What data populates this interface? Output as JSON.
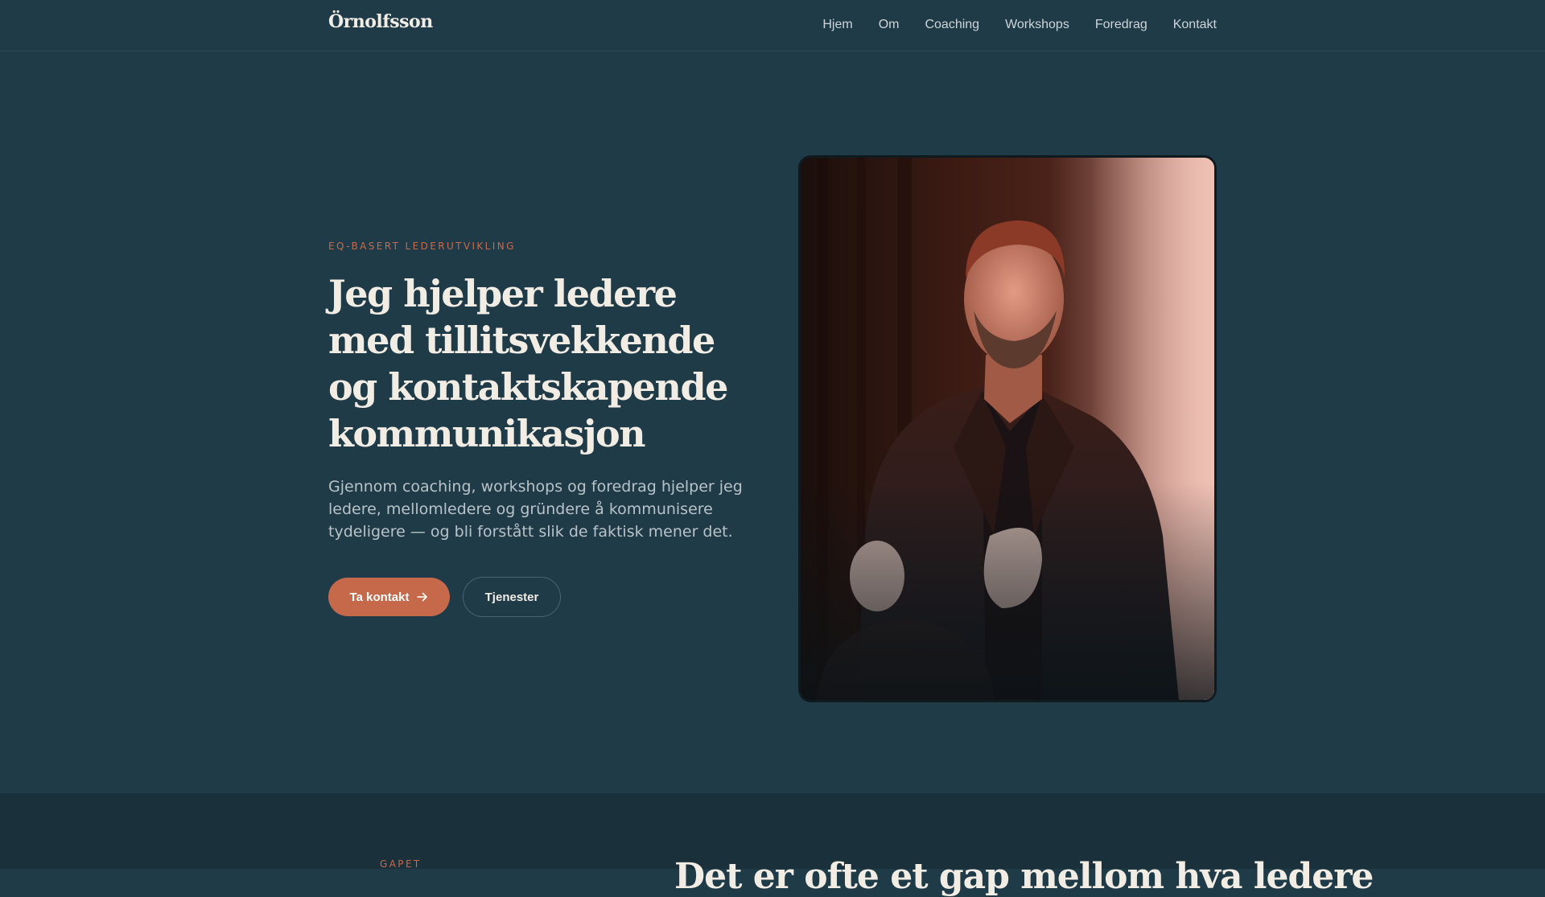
{
  "header": {
    "brand": "Örnolfsson",
    "nav": [
      "Hjem",
      "Om",
      "Coaching",
      "Workshops",
      "Foredrag",
      "Kontakt"
    ]
  },
  "hero": {
    "eyebrow": "EQ-BASERT LEDERUTVIKLING",
    "headline": "Jeg hjelper ledere med tillitsvekkende og kontaktskapende kommunikasjon",
    "lede": "Gjennom coaching, workshops og foredrag hjelper jeg ledere, mellomledere og gründere å kommunisere tydeligere — og bli forstått slik de faktisk mener det.",
    "primary_button": "Ta kontakt",
    "secondary_button": "Tjenester",
    "photo_icon": "speaker-portrait"
  },
  "gap_section": {
    "eyebrow": "GAPET",
    "heading": "Det er ofte et gap mellom hva ledere"
  },
  "colors": {
    "background": "#1f3b48",
    "accent": "#c6694b",
    "text": "#f1ece4"
  }
}
